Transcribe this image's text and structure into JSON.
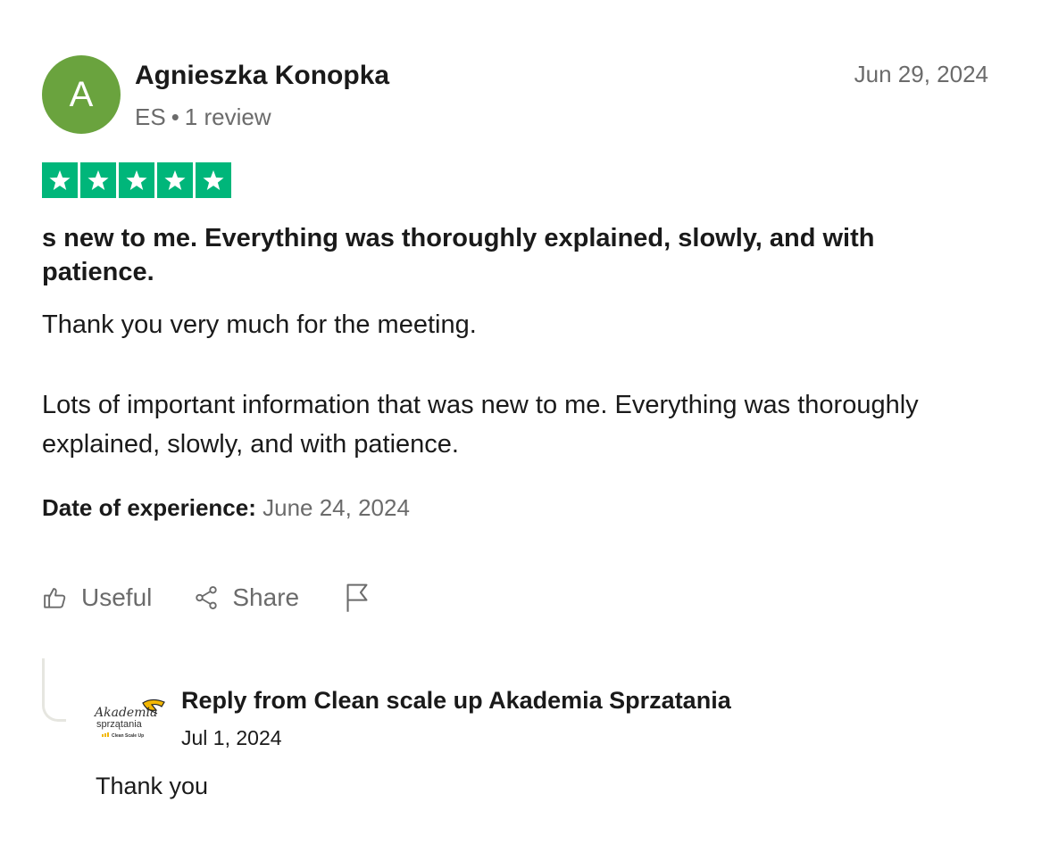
{
  "review": {
    "avatar_initial": "A",
    "author_name": "Agnieszka Konopka",
    "country": "ES",
    "separator": "•",
    "review_count": "1 review",
    "date": "Jun 29, 2024",
    "rating": 5,
    "title": "s new to me. Everything was thoroughly explained, slowly, and with patience.",
    "body_paragraphs": [
      "Thank you very much for the meeting.",
      "Lots of important information that was new to me. Everything was thoroughly explained, slowly, and with patience."
    ],
    "experience_label": "Date of experience:",
    "experience_date": "June 24, 2024"
  },
  "actions": {
    "useful_label": "Useful",
    "share_label": "Share"
  },
  "reply": {
    "logo_script": "Akademia",
    "logo_word": "sprzątania",
    "logo_tagline": "Clean Scale Up",
    "title": "Reply from Clean scale up Akademia Sprzatania",
    "date": "Jul 1, 2024",
    "text": "Thank you"
  },
  "colors": {
    "avatar": "#6aa33e",
    "star": "#00b67a",
    "muted_text": "#6b6b6b"
  }
}
